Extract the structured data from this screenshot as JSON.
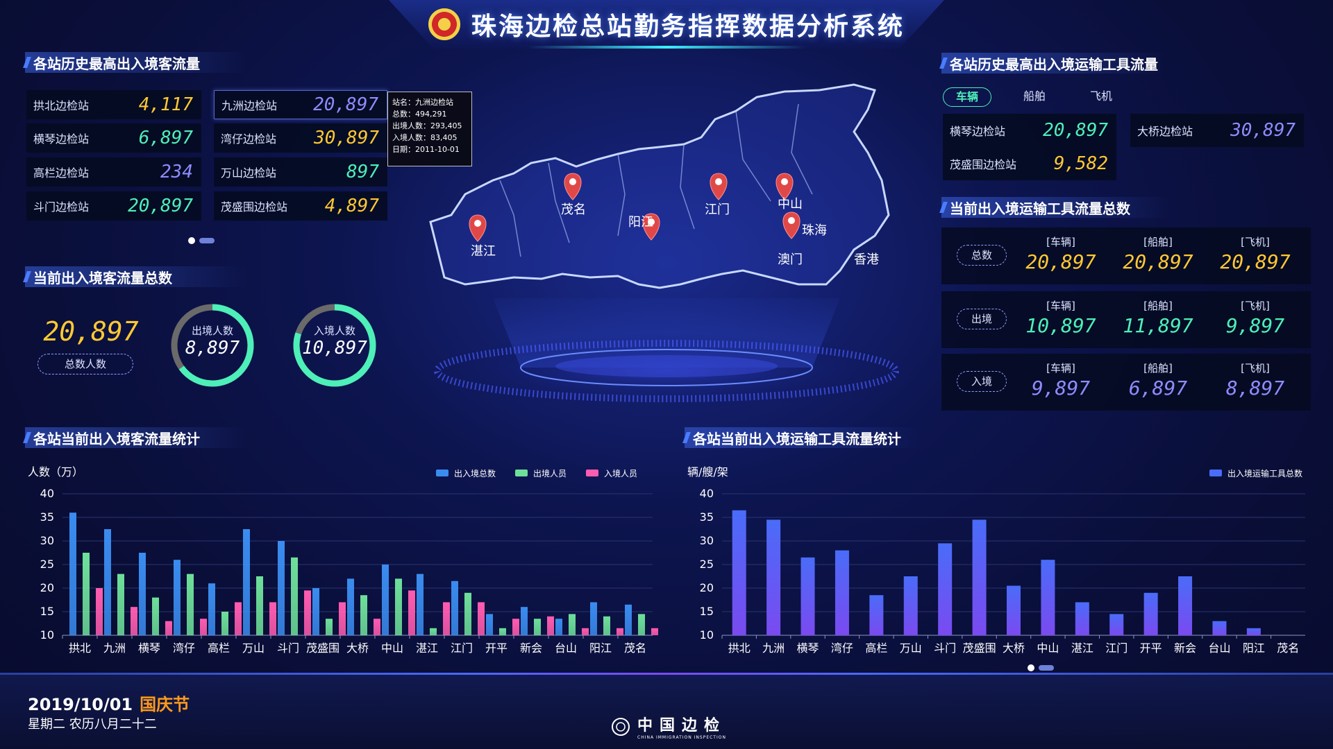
{
  "header": {
    "title": "珠海边检总站勤务指挥数据分析系统"
  },
  "passenger_history": {
    "title": "各站历史最高出入境客流量",
    "stations": [
      {
        "name": "拱北边检站",
        "value": "4,117",
        "color": "#ffc933"
      },
      {
        "name": "横琴边检站",
        "value": "6,897",
        "color": "#4df0b8"
      },
      {
        "name": "高栏边检站",
        "value": "234",
        "color": "#8e8cff"
      },
      {
        "name": "斗门边检站",
        "value": "20,897",
        "color": "#4df0b8"
      },
      {
        "name": "九洲边检站",
        "value": "20,897",
        "color": "#8e8cff"
      },
      {
        "name": "湾仔边检站",
        "value": "30,897",
        "color": "#ffc933"
      },
      {
        "name": "万山边检站",
        "value": "897",
        "color": "#4df0b8"
      },
      {
        "name": "茂盛围边检站",
        "value": "4,897",
        "color": "#ffc933"
      }
    ]
  },
  "tooltip": {
    "line1": "站名：九洲边检站",
    "line2": "总数：494,291",
    "line3": "出境人数：293,405",
    "line4": "入境人数：83,405",
    "line5": "日期：2011-10-01"
  },
  "passenger_current": {
    "title": "当前出入境客流量总数",
    "total_value": "20,897",
    "total_label": "总数人数",
    "exit_label": "出境人数",
    "exit_value": "8,897",
    "exit_fraction": 0.65,
    "entry_label": "入境人数",
    "entry_value": "10,897",
    "entry_fraction": 0.8
  },
  "map": {
    "cities": [
      "湛江",
      "茂名",
      "阳江",
      "江门",
      "中山",
      "珠海",
      "澳门",
      "香港"
    ]
  },
  "transport_history": {
    "title": "各站历史最高出入境运输工具流量",
    "tabs": [
      "车辆",
      "船舶",
      "飞机"
    ],
    "stations": [
      {
        "name": "横琴边检站",
        "value": "20,897",
        "color": "#4df0b8"
      },
      {
        "name": "大桥边检站",
        "value": "30,897",
        "color": "#8e8cff"
      },
      {
        "name": "茂盛围边检站",
        "value": "9,582",
        "color": "#ffc933"
      }
    ]
  },
  "transport_current": {
    "title": "当前出入境运输工具流量总数",
    "headers": [
      "[车辆]",
      "[船舶]",
      "[飞机]"
    ],
    "rows": [
      {
        "label": "总数",
        "values": [
          "20,897",
          "20,897",
          "20,897"
        ],
        "color": "#ffc933"
      },
      {
        "label": "出境",
        "values": [
          "10,897",
          "11,897",
          "9,897"
        ],
        "color": "#4df0b8"
      },
      {
        "label": "入境",
        "values": [
          "9,897",
          "6,897",
          "8,897"
        ],
        "color": "#8e8cff"
      }
    ]
  },
  "passenger_chart_title": "各站当前出入境客流量统计",
  "transport_chart_title": "各站当前出入境运输工具流量统计",
  "chart_data": [
    {
      "type": "bar",
      "ylabel": "人数（万）",
      "ylim": [
        10,
        40
      ],
      "yticks": [
        10,
        15,
        20,
        25,
        30,
        35,
        40
      ],
      "categories": [
        "拱北",
        "九洲",
        "横琴",
        "湾仔",
        "高栏",
        "万山",
        "斗门",
        "茂盛围",
        "大桥",
        "中山",
        "湛江",
        "江门",
        "开平",
        "新会",
        "台山",
        "阳江",
        "茂名"
      ],
      "series": [
        {
          "name": "出入境总数",
          "color": "#3a8cf0",
          "values": [
            36,
            32.5,
            27.5,
            26,
            21,
            32.5,
            30,
            20,
            22,
            25,
            23,
            21.5,
            14.5,
            16,
            13.5,
            17,
            16.5
          ]
        },
        {
          "name": "出境人员",
          "color": "#6ee09a",
          "values": [
            27.5,
            23,
            18,
            23,
            15,
            22.5,
            26.5,
            13.5,
            18.5,
            22,
            11.5,
            19,
            11.5,
            13.5,
            14.5,
            14,
            14.5
          ]
        },
        {
          "name": "入境人员",
          "color": "#ff5cb0",
          "values": [
            20,
            16,
            13,
            13.5,
            17,
            17,
            19.5,
            17,
            13.5,
            19.5,
            17,
            17,
            13.5,
            14,
            11.5,
            11.5,
            11.5
          ]
        }
      ],
      "legend": "top-right"
    },
    {
      "type": "bar",
      "ylabel": "辆/艘/架",
      "ylim": [
        10,
        40
      ],
      "yticks": [
        10,
        15,
        20,
        25,
        30,
        35,
        40
      ],
      "categories": [
        "拱北",
        "九洲",
        "横琴",
        "湾仔",
        "高栏",
        "万山",
        "斗门",
        "茂盛围",
        "大桥",
        "中山",
        "湛江",
        "江门",
        "开平",
        "新会",
        "台山",
        "阳江",
        "茂名"
      ],
      "series": [
        {
          "name": "出入境运输工具总数",
          "color": "#4a6cf8",
          "values": [
            36.5,
            34.5,
            26.5,
            28,
            18.5,
            22.5,
            29.5,
            34.5,
            20.5,
            26,
            17,
            14.5,
            19,
            22.5,
            13,
            11.5
          ]
        }
      ],
      "legend": "top-right"
    }
  ],
  "footer": {
    "date": "2019/10/01",
    "holiday": "国庆节",
    "weekday": "星期二  农历八月二十二",
    "logo_text": "中国边检",
    "logo_sub": "CHINA IMMIGRATION INSPECTION"
  },
  "colors": {
    "accent_yellow": "#ffc933",
    "accent_green": "#4df0b8",
    "accent_purple": "#8e8cff",
    "pin_red": "#e04848"
  }
}
